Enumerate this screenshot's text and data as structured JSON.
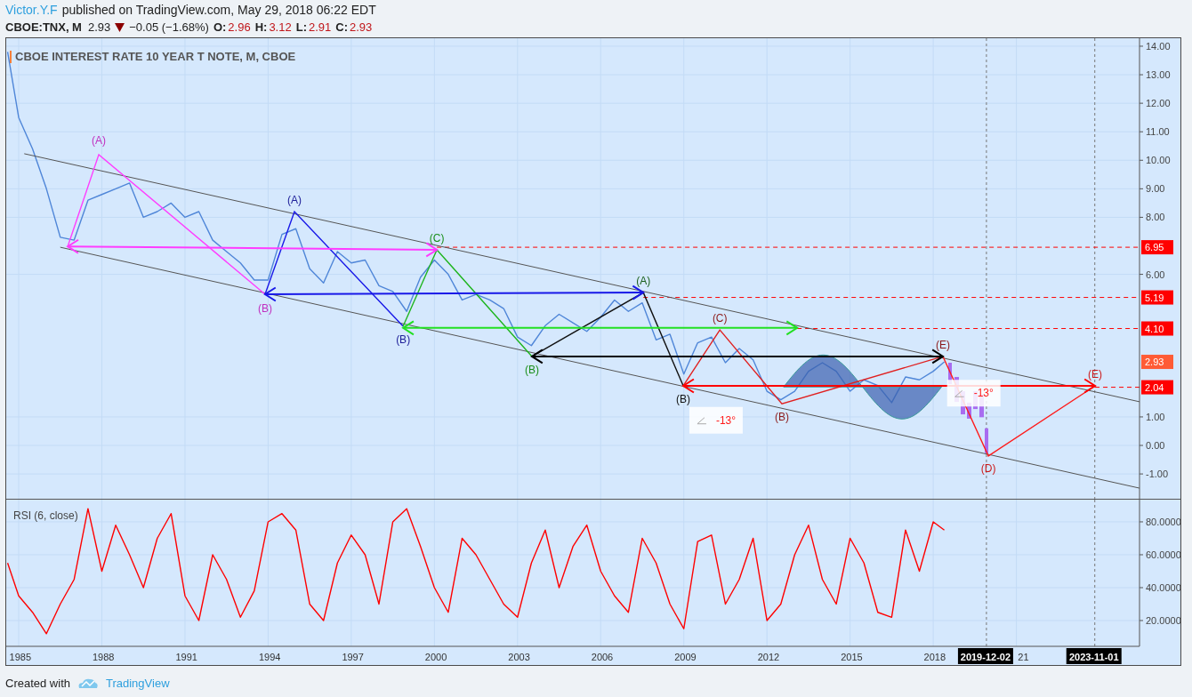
{
  "header": {
    "author": "Victor.Y.F",
    "published": "published on TradingView.com, May 29, 2018 06:22 EDT",
    "symbol": "CBOE:TNX, M",
    "last": "2.93",
    "falling": true,
    "change": "−0.05 (−1.68%)",
    "ohlc": [
      {
        "label": "O:",
        "value": "2.96"
      },
      {
        "label": "H:",
        "value": "3.12"
      },
      {
        "label": "L:",
        "value": "2.91"
      },
      {
        "label": "C:",
        "value": "2.93"
      }
    ]
  },
  "price_chart": {
    "title": "CBOE INTEREST RATE 10 YEAR T NOTE, M, CBOE",
    "last_price_tag": "2.93",
    "wave_labels": [
      {
        "text": "(A)",
        "color": "#c030c0"
      },
      {
        "text": "(B)",
        "color": "#c030c0"
      },
      {
        "text": "(A)",
        "color": "#20209a"
      },
      {
        "text": "(B)",
        "color": "#20209a"
      },
      {
        "text": "(C)",
        "color": "#1a8f1a"
      },
      {
        "text": "(B)",
        "color": "#1a8f1a"
      },
      {
        "text": "(A)",
        "color": "#1a5f1a"
      },
      {
        "text": "(B)",
        "color": "#111111"
      },
      {
        "text": "(C)",
        "color": "#8b1a1a"
      },
      {
        "text": "(B)",
        "color": "#8b1a1a"
      },
      {
        "text": "(E)",
        "color": "#8b1a1a"
      },
      {
        "text": "(D)",
        "color": "#cc1a1a"
      },
      {
        "text": "(E)",
        "color": "#cc1a1a"
      }
    ],
    "angle_labels": [
      "-13°",
      "-13°"
    ],
    "chart_data": {
      "type": "line",
      "grid": true,
      "x": [
        1984.6,
        1985,
        1985.5,
        1986,
        1986.5,
        1987,
        1987.5,
        1988,
        1988.5,
        1989,
        1989.5,
        1990,
        1990.5,
        1991,
        1991.5,
        1992,
        1992.5,
        1993,
        1993.5,
        1994,
        1994.5,
        1995,
        1995.5,
        1996,
        1996.5,
        1997,
        1997.5,
        1998,
        1998.5,
        1999,
        1999.5,
        2000,
        2000.5,
        2001,
        2001.5,
        2002,
        2002.5,
        2003,
        2003.5,
        2004,
        2004.5,
        2005,
        2005.5,
        2006,
        2006.5,
        2007,
        2007.5,
        2008,
        2008.5,
        2009,
        2009.5,
        2010,
        2010.5,
        2011,
        2011.5,
        2012,
        2012.5,
        2013,
        2013.5,
        2014,
        2014.5,
        2015,
        2015.5,
        2016,
        2016.5,
        2017,
        2017.5,
        2018,
        2018.4
      ],
      "series": [
        {
          "color": "#4f86d8",
          "values": [
            13.8,
            11.5,
            10.4,
            9.0,
            7.3,
            7.2,
            8.6,
            8.8,
            9.0,
            9.2,
            8.0,
            8.2,
            8.5,
            8.0,
            8.2,
            7.2,
            6.8,
            6.4,
            5.8,
            5.8,
            7.4,
            7.6,
            6.2,
            5.7,
            6.8,
            6.4,
            6.5,
            5.6,
            5.4,
            4.7,
            5.9,
            6.5,
            6.0,
            5.1,
            5.3,
            5.1,
            4.8,
            3.8,
            3.5,
            4.2,
            4.6,
            4.3,
            4.0,
            4.5,
            5.1,
            4.7,
            5.0,
            3.7,
            3.9,
            2.5,
            3.6,
            3.8,
            2.9,
            3.4,
            3.0,
            1.9,
            1.6,
            1.9,
            2.6,
            2.9,
            2.6,
            1.9,
            2.3,
            2.1,
            1.5,
            2.4,
            2.3,
            2.6,
            2.93
          ]
        }
      ],
      "xlim": [
        1984.55,
        2026.92
      ],
      "ylim": [
        -1.87,
        14.28
      ],
      "yticks": [
        {
          "value": 14,
          "label": "14.00"
        },
        {
          "value": 13,
          "label": "13.00"
        },
        {
          "value": 12,
          "label": "12.00"
        },
        {
          "value": 11,
          "label": "11.00"
        },
        {
          "value": 10,
          "label": "10.00"
        },
        {
          "value": 9,
          "label": "9.00"
        },
        {
          "value": 8,
          "label": "8.00"
        },
        {
          "value": 6,
          "label": "6.00"
        },
        {
          "value": 1,
          "label": "1.00"
        },
        {
          "value": 0,
          "label": "0.00"
        },
        {
          "value": -1,
          "label": "-1.00"
        }
      ],
      "ref_lines": [
        {
          "axis": "y",
          "value": 6.95,
          "label": "6.95",
          "color": "#ff0000"
        },
        {
          "axis": "y",
          "value": 5.19,
          "label": "5.19",
          "color": "#ff0000"
        },
        {
          "axis": "y",
          "value": 4.1,
          "label": "4.10",
          "color": "#ff0000"
        },
        {
          "axis": "y",
          "value": 2.04,
          "label": "2.04",
          "color": "#ff0000"
        },
        {
          "axis": "x",
          "value": 2019.92,
          "color": "#777777"
        },
        {
          "axis": "x",
          "value": 2023.83,
          "color": "#777777"
        }
      ]
    }
  },
  "rsi_chart": {
    "title": "RSI (6, close)",
    "chart_data": {
      "type": "line",
      "grid": true,
      "x": [
        1984.6,
        1985,
        1985.5,
        1986,
        1986.5,
        1987,
        1987.5,
        1988,
        1988.5,
        1989,
        1989.5,
        1990,
        1990.5,
        1991,
        1991.5,
        1992,
        1992.5,
        1993,
        1993.5,
        1994,
        1994.5,
        1995,
        1995.5,
        1996,
        1996.5,
        1997,
        1997.5,
        1998,
        1998.5,
        1999,
        1999.5,
        2000,
        2000.5,
        2001,
        2001.5,
        2002,
        2002.5,
        2003,
        2003.5,
        2004,
        2004.5,
        2005,
        2005.5,
        2006,
        2006.5,
        2007,
        2007.5,
        2008,
        2008.5,
        2009,
        2009.5,
        2010,
        2010.5,
        2011,
        2011.5,
        2012,
        2012.5,
        2013,
        2013.5,
        2014,
        2014.5,
        2015,
        2015.5,
        2016,
        2016.5,
        2017,
        2017.5,
        2018,
        2018.4
      ],
      "series": [
        {
          "color": "#ff0000",
          "values": [
            55,
            35,
            25,
            12,
            30,
            45,
            88,
            50,
            78,
            60,
            40,
            70,
            85,
            35,
            20,
            60,
            45,
            22,
            38,
            80,
            85,
            75,
            30,
            20,
            55,
            72,
            60,
            30,
            80,
            88,
            65,
            40,
            25,
            70,
            60,
            45,
            30,
            22,
            55,
            75,
            40,
            65,
            78,
            50,
            35,
            25,
            70,
            55,
            30,
            15,
            68,
            72,
            30,
            45,
            70,
            20,
            30,
            60,
            78,
            45,
            30,
            70,
            55,
            25,
            22,
            75,
            50,
            80,
            75
          ]
        }
      ],
      "xlim": [
        1984.55,
        2026.92
      ],
      "ylim": [
        4.32,
        93.5
      ],
      "yticks": [
        {
          "value": 80,
          "label": "80.0000"
        },
        {
          "value": 60,
          "label": "60.0000"
        },
        {
          "value": 40,
          "label": "40.0000"
        },
        {
          "value": 20,
          "label": "20.0000"
        }
      ],
      "xticks": [
        {
          "value": 1985,
          "label": "1985"
        },
        {
          "value": 1988,
          "label": "1988"
        },
        {
          "value": 1991,
          "label": "1991"
        },
        {
          "value": 1994,
          "label": "1994"
        },
        {
          "value": 1997,
          "label": "1997"
        },
        {
          "value": 2000,
          "label": "2000"
        },
        {
          "value": 2003,
          "label": "2003"
        },
        {
          "value": 2006,
          "label": "2006"
        },
        {
          "value": 2009,
          "label": "2009"
        },
        {
          "value": 2012,
          "label": "2012"
        },
        {
          "value": 2015,
          "label": "2015"
        },
        {
          "value": 2018,
          "label": "2018"
        },
        {
          "value": 2021,
          "label": "21"
        }
      ],
      "ref_lines": [
        {
          "axis": "x",
          "value": 2019.92,
          "color": "#777777"
        },
        {
          "axis": "x",
          "value": 2023.83,
          "color": "#777777"
        }
      ]
    },
    "date_markers": [
      "2019-12-02",
      "2023-11-01"
    ]
  },
  "footer": {
    "prefix": "Created with",
    "brand": "TradingView"
  }
}
